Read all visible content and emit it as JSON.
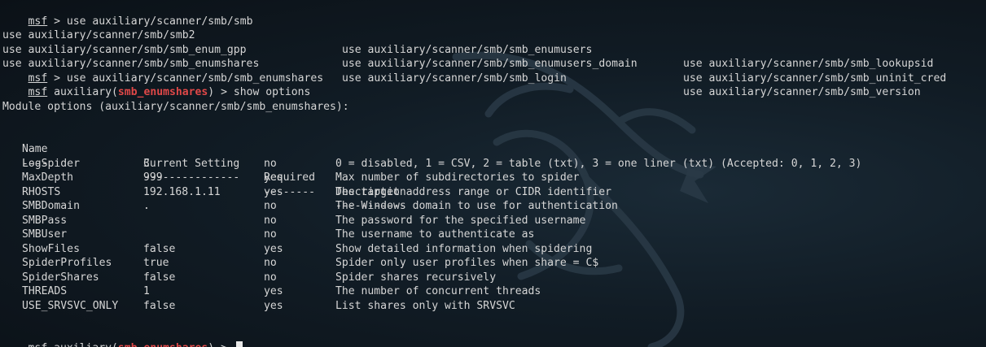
{
  "terminal": {
    "prompt_name": "msf",
    "lines_top": [
      {
        "prefix": " > ",
        "command": "use auxiliary/scanner/smb/smb"
      }
    ],
    "completion_rows": [
      [
        "use auxiliary/scanner/smb/smb2",
        "use auxiliary/scanner/smb/smb_enumusers",
        "use auxiliary/scanner/smb/smb_lookupsid"
      ],
      [
        "use auxiliary/scanner/smb/smb_enum_gpp",
        "use auxiliary/scanner/smb/smb_enumusers_domain",
        "use auxiliary/scanner/smb/smb_uninit_cred"
      ],
      [
        "use auxiliary/scanner/smb/smb_enumshares",
        "use auxiliary/scanner/smb/smb_login",
        "use auxiliary/scanner/smb/smb_version"
      ]
    ],
    "use_line": {
      "prefix": " > ",
      "command": "use auxiliary/scanner/smb/smb_enumshares"
    },
    "module_prefix": " auxiliary(",
    "module_name": "smb_enumshares",
    "module_suffix": ") > ",
    "show_command": "show options",
    "options_header": "Module options (auxiliary/scanner/smb/smb_enumshares):",
    "table": {
      "headers": [
        "Name",
        "Current Setting",
        "Required",
        "Description"
      ],
      "separators": [
        "----",
        "---------------",
        "--------",
        "-----------"
      ],
      "rows": [
        [
          "LogSpider",
          "3",
          "no",
          "0 = disabled, 1 = CSV, 2 = table (txt), 3 = one liner (txt) (Accepted: 0, 1, 2, 3)"
        ],
        [
          "MaxDepth",
          "999",
          "yes",
          "Max number of subdirectories to spider"
        ],
        [
          "RHOSTS",
          "192.168.1.11",
          "yes",
          "The target address range or CIDR identifier"
        ],
        [
          "SMBDomain",
          ".",
          "no",
          "The Windows domain to use for authentication"
        ],
        [
          "SMBPass",
          "",
          "no",
          "The password for the specified username"
        ],
        [
          "SMBUser",
          "",
          "no",
          "The username to authenticate as"
        ],
        [
          "ShowFiles",
          "false",
          "yes",
          "Show detailed information when spidering"
        ],
        [
          "SpiderProfiles",
          "true",
          "no",
          "Spider only user profiles when share = C$"
        ],
        [
          "SpiderShares",
          "false",
          "no",
          "Spider shares recursively"
        ],
        [
          "THREADS",
          "1",
          "yes",
          "The number of concurrent threads"
        ],
        [
          "USE_SRVSVC_ONLY",
          "false",
          "yes",
          "List shares only with SRVSVC"
        ]
      ]
    },
    "final_prompt_input": ""
  },
  "colors": {
    "background": "#111c25",
    "text": "#d6d6d6",
    "module_name": "#e04848",
    "cursor": "#e8e8e8"
  },
  "icons": {
    "background_watermark": "kali-dragon-icon"
  }
}
